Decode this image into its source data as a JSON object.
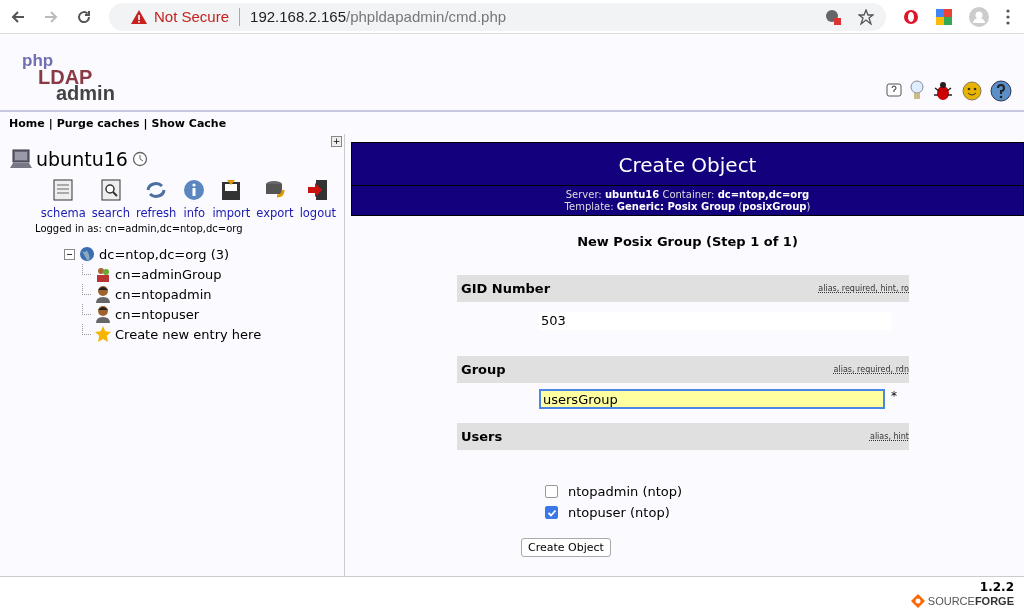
{
  "browser": {
    "security": "Not Secure",
    "url_host": "192.168.2.165",
    "url_path": "/phpldapadmin/cmd.php"
  },
  "logo": {
    "line_1": "php",
    "line_2": "LDAP",
    "line_3": "admin"
  },
  "nav": [
    "Home",
    "Purge caches",
    "Show Cache"
  ],
  "nav_separator": "|",
  "sidebar": {
    "expand_toggle": "+",
    "server": "ubuntu16",
    "tools": [
      "schema",
      "search",
      "refresh",
      "info",
      "import",
      "export",
      "logout"
    ],
    "logged_in": "Logged in as: cn=admin,dc=ntop,dc=org",
    "tree": {
      "label": "dc=ntop,dc=org (3)",
      "expanded": true,
      "children": [
        {
          "label": "cn=adminGroup",
          "kind": "group"
        },
        {
          "label": "cn=ntopadmin",
          "kind": "user"
        },
        {
          "label": "cn=ntopuser",
          "kind": "user"
        },
        {
          "label": "Create new entry here",
          "kind": "new"
        }
      ]
    }
  },
  "panel": {
    "title": "Create Object",
    "info_line_1": "Server: **ubuntu16**   Container: **dc=ntop,dc=org**",
    "info_line_2": "Template: **Generic: Posix Group** (**posixGroup**)",
    "step": "New Posix Group (Step 1 of 1)",
    "attributes": [
      {
        "name": "GID Number",
        "hints": "alias, required, hint, ro",
        "kind": "readonly",
        "value": "503"
      },
      {
        "name": "Group",
        "hints": "alias, required, rdn",
        "kind": "input",
        "value": "usersGroup",
        "required_mark": "*",
        "focused": true
      },
      {
        "name": "Users",
        "hints": "alias, hint",
        "kind": "checklist",
        "options": [
          {
            "label": "ntopadmin (ntop)",
            "checked": false
          },
          {
            "label": "ntopuser (ntop)",
            "checked": true
          }
        ]
      }
    ],
    "submit": "Create Object"
  },
  "footer": {
    "version": "1.2.2",
    "brand": "SOURCE**FORGE**"
  }
}
